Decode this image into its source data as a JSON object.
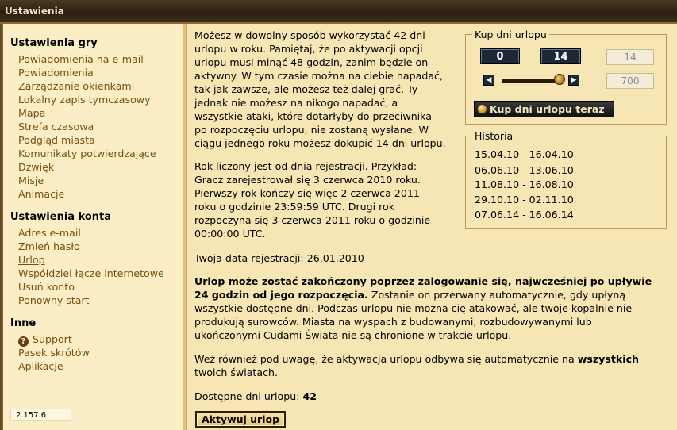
{
  "window": {
    "title": "Ustawienia"
  },
  "sidebar": {
    "game_settings_title": "Ustawienia gry",
    "game_settings_items": [
      "Powiadomienia na e-mail",
      "Powiadomienia",
      "Zarządzanie okienkami",
      "Lokalny zapis tymczasowy",
      "Mapa",
      "Strefa czasowa",
      "Podgląd miasta",
      "Komunikaty potwierdzające",
      "Dźwięk",
      "Misje",
      "Animacje"
    ],
    "account_settings_title": "Ustawienia konta",
    "account_settings_items": [
      "Adres e-mail",
      "Zmień hasło",
      "Urlop",
      "Współdziel łącze internetowe",
      "Usuń konto",
      "Ponowny start"
    ],
    "other_title": "Inne",
    "other_items": [
      "Support",
      "Pasek skrótów",
      "Aplikacje"
    ],
    "version": "2.157.6"
  },
  "main": {
    "intro_lines": [
      "Możesz w dowolny sposób wykorzystać 42 dni",
      "urlopu w roku. Pamiętaj, że po aktywacji opcji",
      "urlopu musi minąć 48 godzin, zanim będzie on",
      "aktywny. W tym czasie można na ciebie napadać,",
      "tak jak zawsze, ale możesz też dalej grać. Ty",
      "jednak nie możesz na nikogo napadać, a",
      "wszystkie ataki, które dotarłyby do przeciwnika",
      "po rozpoczęciu urlopu, nie zostaną wysłane. W",
      "ciągu jednego roku możesz dokupić 14 dni urlopu."
    ],
    "example_lines": [
      "Rok liczony jest od dnia rejestracji. Przykład:",
      "Gracz zarejestrował się 3 czerwca 2010 roku.",
      "Pierwszy rok kończy się więc 2 czerwca 2011",
      "roku o godzinie 23:59:59 UTC. Drugi rok",
      "rozpoczyna się 3 czerwca 2011 roku o godzinie",
      "00:00:00 UTC."
    ],
    "registration_label": "Twoja data rejestracji:",
    "registration_date": "26.01.2010",
    "bold_line_1": "Urlop może zostać zakończony poprzez zalogowanie się, najwcześniej po upływie",
    "bold_line_2": "24 godzin od jego rozpoczęcia.",
    "bold_line_2_rest": " Zostanie on przerwany automatycznie, gdy upłyną",
    "info_lines": [
      "wszystkie dostępne dni. Podczas urlopu nie można cię atakować, ale twoje kopalnie nie",
      "produkują surowców. Miasta na wyspach z budowanymi, rozbudowywanymi lub",
      "ukończonymi Cudami Świata nie są chronione w trakcie urlopu."
    ],
    "note_line_1_start": "Weź również pod uwagę, że aktywacja urlopu odbywa się automatycznie na ",
    "note_line_1_bold": "wszystkich",
    "note_line_2": "twoich światach.",
    "available_label": "Dostępne dni urlopu:",
    "available_days": "42",
    "activate_button": "Aktywuj urlop"
  },
  "buy_panel": {
    "title": "Kup dni urlopu",
    "min_value": "0",
    "max_value": "14",
    "days_input": "14",
    "cost_input": "700",
    "slider_level_fraction": 1.0,
    "buy_button": "Kup dni urlopu teraz"
  },
  "history": {
    "title": "Historia",
    "entries": [
      "15.04.10 - 16.04.10",
      "06.06.10 - 13.06.10",
      "11.08.10 - 16.08.10",
      "29.10.10 - 02.11.10",
      "07.06.14 - 16.06.14"
    ]
  },
  "colors": {
    "background": "#f6e6b4",
    "link": "#7a4f0f",
    "dark_value_box": "#1c2737"
  }
}
